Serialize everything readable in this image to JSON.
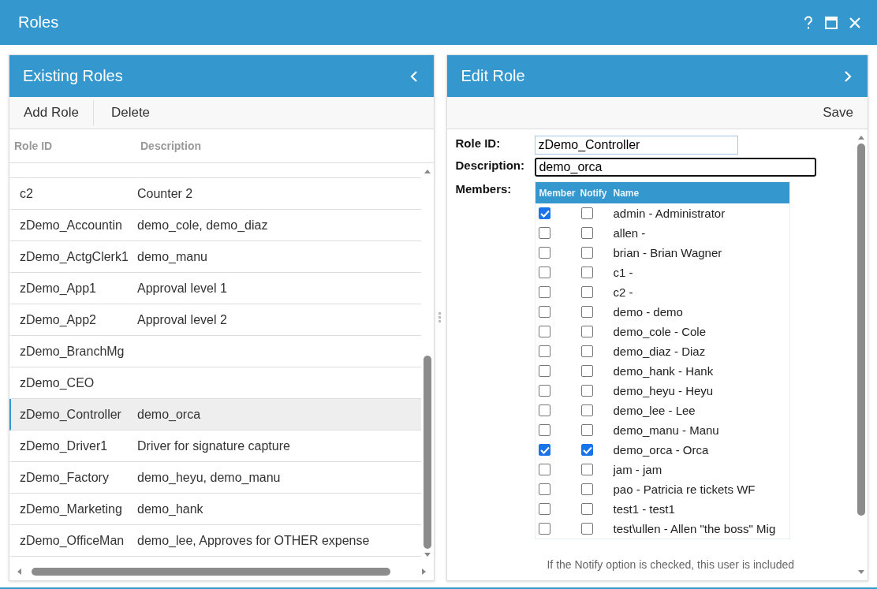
{
  "window": {
    "title": "Roles"
  },
  "existing_roles": {
    "title": "Existing Roles",
    "toolbar": [
      "Add Role",
      "Delete"
    ],
    "columns": [
      "Role ID",
      "Description"
    ],
    "rows": [
      {
        "role_id": "c2",
        "description": "Counter 2",
        "selected": false
      },
      {
        "role_id": "zDemo_Accountin",
        "description": "demo_cole, demo_diaz",
        "selected": false
      },
      {
        "role_id": "zDemo_ActgClerk1",
        "description": "demo_manu",
        "selected": false
      },
      {
        "role_id": "zDemo_App1",
        "description": "Approval level 1",
        "selected": false
      },
      {
        "role_id": "zDemo_App2",
        "description": "Approval level 2",
        "selected": false
      },
      {
        "role_id": "zDemo_BranchMg",
        "description": "",
        "selected": false
      },
      {
        "role_id": "zDemo_CEO",
        "description": "",
        "selected": false
      },
      {
        "role_id": "zDemo_Controller",
        "description": "demo_orca",
        "selected": true
      },
      {
        "role_id": "zDemo_Driver1",
        "description": "Driver for signature capture",
        "selected": false
      },
      {
        "role_id": "zDemo_Factory",
        "description": "demo_heyu, demo_manu",
        "selected": false
      },
      {
        "role_id": "zDemo_Marketing",
        "description": "demo_hank",
        "selected": false
      },
      {
        "role_id": "zDemo_OfficeMan",
        "description": "demo_lee, Approves for OTHER expense",
        "selected": false
      }
    ]
  },
  "edit_role": {
    "title": "Edit Role",
    "save": "Save",
    "role_id": {
      "label": "Role ID:",
      "value": "zDemo_Controller"
    },
    "description": {
      "label": "Description:",
      "value": "demo_orca"
    },
    "members_label": "Members:",
    "member_columns": [
      "Member",
      "Notify",
      "Name"
    ],
    "members": [
      {
        "member": true,
        "notify": false,
        "name": "admin - Administrator"
      },
      {
        "member": false,
        "notify": false,
        "name": "allen -"
      },
      {
        "member": false,
        "notify": false,
        "name": "brian - Brian Wagner"
      },
      {
        "member": false,
        "notify": false,
        "name": "c1 -"
      },
      {
        "member": false,
        "notify": false,
        "name": "c2 -"
      },
      {
        "member": false,
        "notify": false,
        "name": "demo - demo"
      },
      {
        "member": false,
        "notify": false,
        "name": "demo_cole - Cole"
      },
      {
        "member": false,
        "notify": false,
        "name": "demo_diaz - Diaz"
      },
      {
        "member": false,
        "notify": false,
        "name": "demo_hank - Hank"
      },
      {
        "member": false,
        "notify": false,
        "name": "demo_heyu - Heyu"
      },
      {
        "member": false,
        "notify": false,
        "name": "demo_lee - Lee"
      },
      {
        "member": false,
        "notify": false,
        "name": "demo_manu - Manu"
      },
      {
        "member": true,
        "notify": true,
        "name": "demo_orca - Orca"
      },
      {
        "member": false,
        "notify": false,
        "name": "jam - jam"
      },
      {
        "member": false,
        "notify": false,
        "name": "pao - Patricia re tickets WF"
      },
      {
        "member": false,
        "notify": false,
        "name": "test1 - test1"
      },
      {
        "member": false,
        "notify": false,
        "name": "test\\ullen - Allen \"the boss\" Mig"
      }
    ],
    "note": "If the Notify option is checked, this user is included"
  }
}
